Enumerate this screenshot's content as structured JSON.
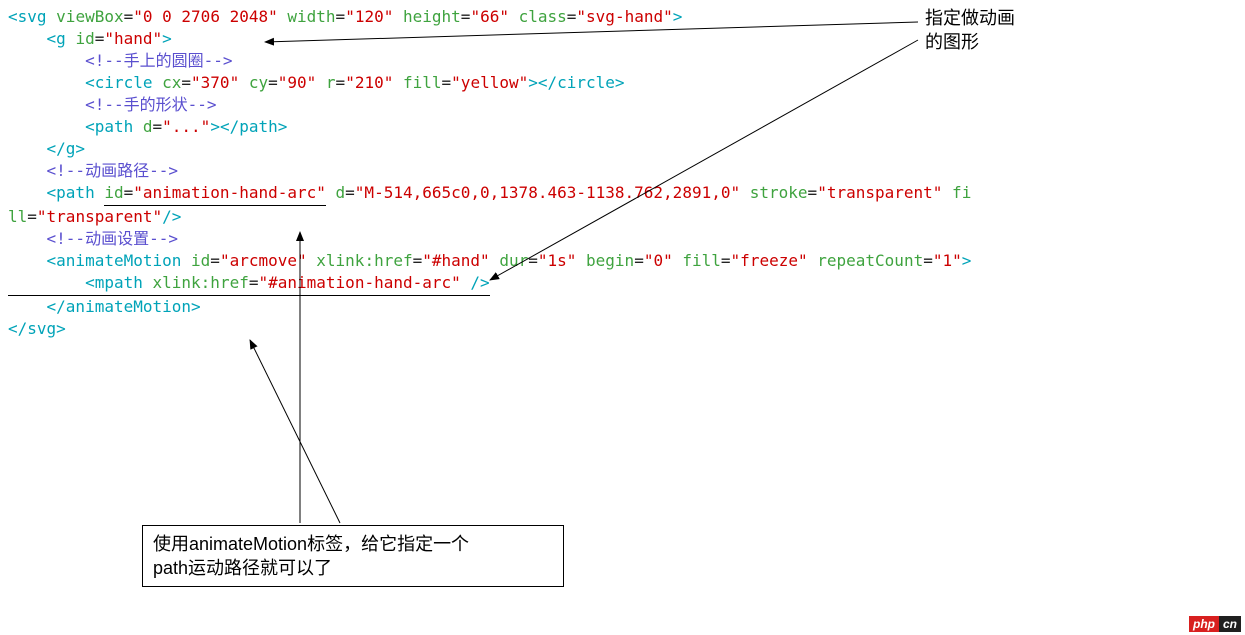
{
  "code": {
    "line1": {
      "t1": "<svg ",
      "a1": "viewBox",
      "e": "=",
      "v1": "\"0 0 2706 2048\"",
      "a2": " width",
      "v2": "\"120\"",
      "a3": " height",
      "v3": "\"66\"",
      "a4": " class",
      "v4": "\"svg-hand\"",
      "t2": ">"
    },
    "line2": {
      "t1": "    <g ",
      "a1": "id",
      "e": "=",
      "v1": "\"hand\"",
      "t2": ">"
    },
    "line3": "        <!--手上的圆圈-->",
    "line4": {
      "t1": "        <circle ",
      "a1": "cx",
      "e": "=",
      "v1": "\"370\"",
      "a2": " cy",
      "v2": "\"90\"",
      "a3": " r",
      "v3": "\"210\"",
      "a4": " fill",
      "v4": "\"yellow\"",
      "t2": "></circle>"
    },
    "line5": "        <!--手的形状-->",
    "line6": {
      "t1": "        <path ",
      "a1": "d",
      "e": "=",
      "v1": "\"...\"",
      "t2": "></path>"
    },
    "line7": "    </g>",
    "line8": "    <!--动画路径-->",
    "line9a": {
      "t1": "    <path ",
      "a1": "id",
      "e": "=",
      "v1": "\"animation-hand-arc\"",
      "a2": " d",
      "v2": "\"M-514,665c0,0,1378.463-1138.762,2891,0\"",
      "a3": " stroke",
      "v3": "\"transparent\"",
      "a4": " fi"
    },
    "line9b": {
      "a4": "ll",
      "e": "=",
      "v4": "\"transparent\"",
      "t2": "/>"
    },
    "line10": "    <!--动画设置-->",
    "line11": {
      "t1": "    <animateMotion ",
      "a1": "id",
      "e": "=",
      "v1": "\"arcmove\"",
      "a2": " xlink",
      "a2b": ":href",
      "v2": "\"#hand\"",
      "a3": " dur",
      "v3": "\"1s\"",
      "a4": " begin",
      "v4": "\"0\"",
      "a5": " fill",
      "v5": "\"freeze\"",
      "a6": " repeatCount",
      "v6": "\"1\"",
      "t2": ">"
    },
    "line12": {
      "t1": "        <mpath ",
      "a1": "xlink",
      "a1b": ":href",
      "e": "=",
      "v1": "\"#animation-hand-arc\"",
      "t2": " />"
    },
    "line13": "    </animateMotion>",
    "line14": "</svg>"
  },
  "annotations": {
    "top_note_l1": "指定做动画",
    "top_note_l2": "的图形",
    "bottom_box_l1": "使用animateMotion标签，给它指定一个",
    "bottom_box_l2": "path运动路径就可以了"
  },
  "logo": {
    "left": "php",
    "right": "cn"
  }
}
